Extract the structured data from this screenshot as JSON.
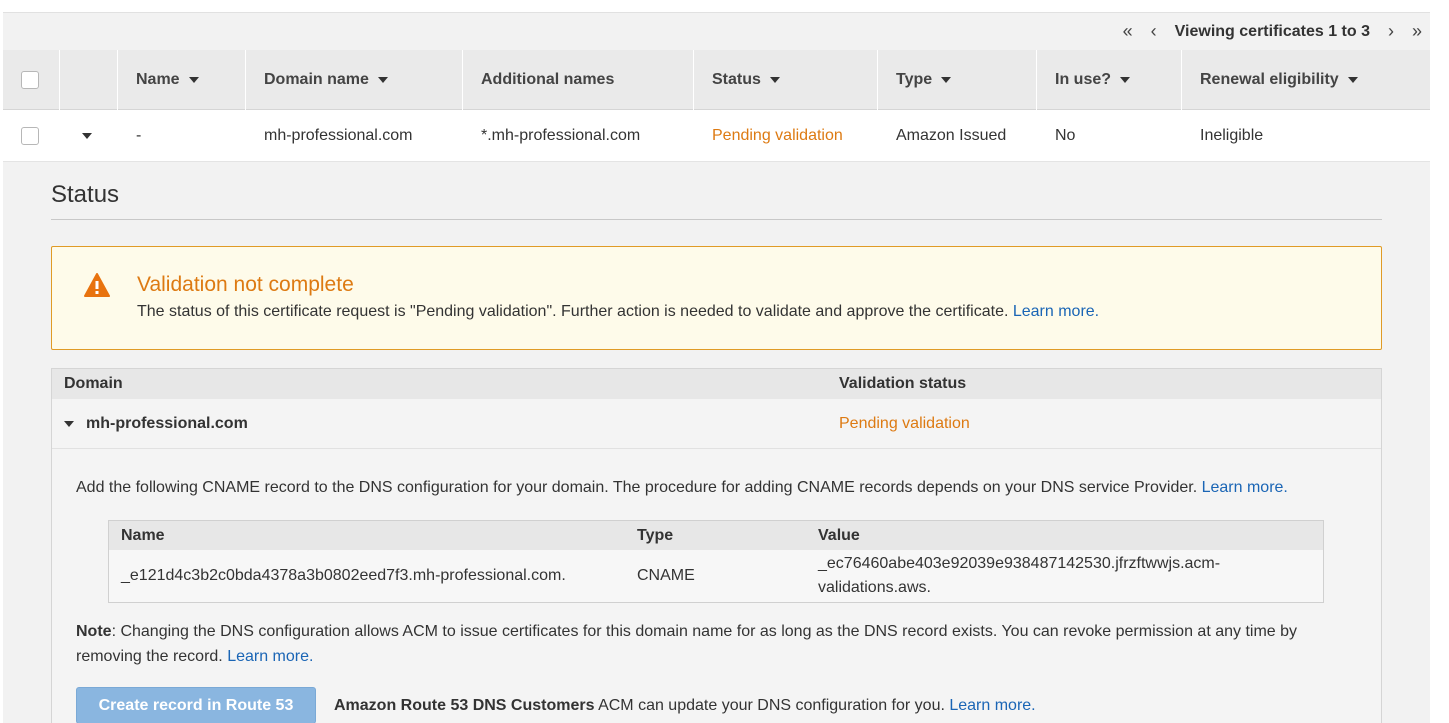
{
  "pager": {
    "first": "«",
    "prev": "‹",
    "text": "Viewing certificates 1 to 3",
    "next": "›",
    "last": "»"
  },
  "table": {
    "columns": {
      "name": "Name",
      "domain": "Domain name",
      "additional": "Additional names",
      "status": "Status",
      "type": "Type",
      "in_use": "In use?",
      "renewal": "Renewal eligibility"
    },
    "row": {
      "name": "-",
      "domain": "mh-professional.com",
      "additional": "*.mh-professional.com",
      "status": "Pending validation",
      "type": "Amazon Issued",
      "in_use": "No",
      "renewal": "Ineligible"
    }
  },
  "detail": {
    "title": "Status",
    "warning": {
      "icon": "warning-icon",
      "title": "Validation not complete",
      "text": "The status of this certificate request is \"Pending validation\". Further action is needed to validate and approve the certificate.",
      "link": "Learn more."
    },
    "validation": {
      "head_domain": "Domain",
      "head_status": "Validation status",
      "domain": "mh-professional.com",
      "status": "Pending validation",
      "instructions": "Add the following CNAME record to the DNS configuration for your domain. The procedure for adding CNAME records depends on your DNS service Provider.",
      "instructions_link": "Learn more.",
      "cname": {
        "head_name": "Name",
        "head_type": "Type",
        "head_value": "Value",
        "name": "_e121d4c3b2c0bda4378a3b0802eed7f3.mh-professional.com.",
        "type": "CNAME",
        "value": "_ec76460abe403e92039e938487142530.jfrzftwwjs.acm-validations.aws."
      },
      "note_label": "Note",
      "note_text": ": Changing the DNS configuration allows ACM to issue certificates for this domain name for as long as the DNS record exists. You can revoke permission at any time by removing the record.",
      "note_link": "Learn more.",
      "route53_button": "Create record in Route 53",
      "route53_bold": "Amazon Route 53 DNS Customers",
      "route53_text": " ACM can update your DNS configuration for you.",
      "route53_link": "Learn more."
    }
  },
  "colors": {
    "orange": "#dd7a12",
    "link": "#1a65b5",
    "button": "#8ab6e0"
  }
}
